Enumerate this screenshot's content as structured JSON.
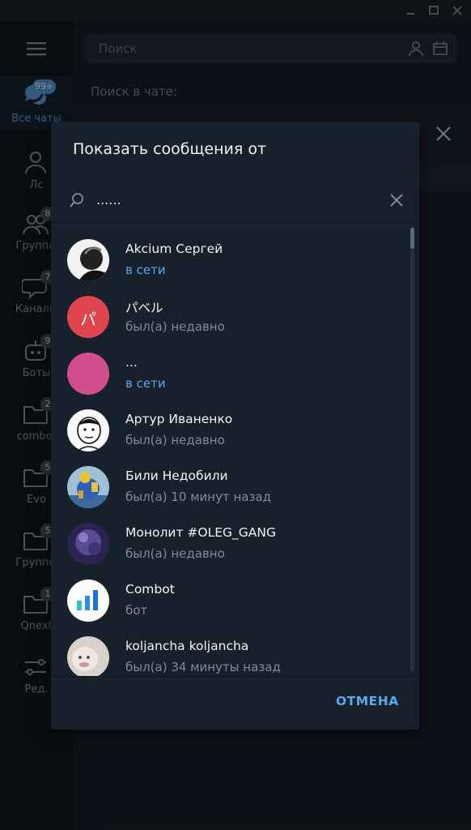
{
  "titlebar": {
    "buttons": [
      "minimize-icon",
      "maximize-icon",
      "close-icon"
    ]
  },
  "sidebar": {
    "items": [
      {
        "label": "Все чаты",
        "badge": "99+",
        "icon": "chats-icon",
        "active": true
      },
      {
        "label": "Лс",
        "badge": "",
        "icon": "person-icon"
      },
      {
        "label": "Группы",
        "badge": "8",
        "icon": "group-icon"
      },
      {
        "label": "Каналы",
        "badge": "7",
        "icon": "channel-icon"
      },
      {
        "label": "Боты",
        "badge": "9",
        "icon": "bot-icon"
      },
      {
        "label": "combot",
        "badge": "2",
        "icon": "folder-icon"
      },
      {
        "label": "Evo",
        "badge": "5",
        "icon": "folder-icon"
      },
      {
        "label": "Группы",
        "badge": "5",
        "icon": "folder-icon"
      },
      {
        "label": "Qnext",
        "badge": "1",
        "icon": "folder-icon"
      },
      {
        "label": "Ред.",
        "badge": "",
        "icon": "edit-filters-icon"
      }
    ]
  },
  "main": {
    "search_placeholder": "Поиск",
    "chat_search_label": "Поиск в чате:"
  },
  "dialog": {
    "title": "Показать сообщения от",
    "search_value": "......",
    "cancel_label": "ОТМЕНА",
    "members": [
      {
        "name": "Akcium Сергей",
        "status": "в сети",
        "online": true,
        "avatar": "bw-photo"
      },
      {
        "name": "パベル",
        "status": "был(а) недавно",
        "online": false,
        "avatar": "letter",
        "letter": "パ",
        "color": "#e0444f"
      },
      {
        "name": "...",
        "status": "в сети",
        "online": true,
        "avatar": "solid",
        "color": "#d14d8e"
      },
      {
        "name": "Артур Иваненко",
        "status": "был(а) недавно",
        "online": false,
        "avatar": "meme-face"
      },
      {
        "name": "Били Недобили",
        "status": "был(а) 10 минут назад",
        "online": false,
        "avatar": "dog-photo"
      },
      {
        "name": "Монолит #OLEG_GANG",
        "status": "был(а) недавно",
        "online": false,
        "avatar": "purple-photo"
      },
      {
        "name": "Combot",
        "status": "бот",
        "online": false,
        "avatar": "chart-logo"
      },
      {
        "name": "koljancha koljancha",
        "status": "был(а) 34 минуты назад",
        "online": false,
        "avatar": "monkey-photo"
      }
    ]
  },
  "colors": {
    "accent": "#5aa9ec",
    "dialog_bg": "#17212b",
    "sidebar_bg": "#111921"
  }
}
